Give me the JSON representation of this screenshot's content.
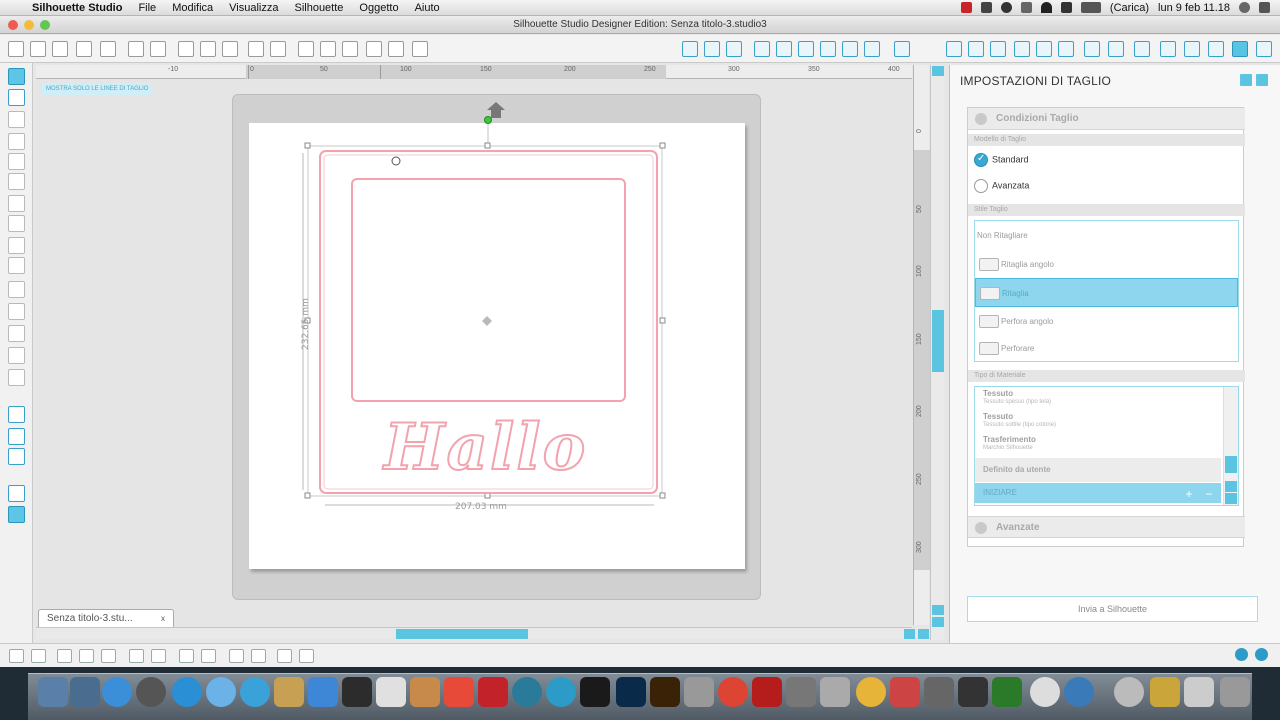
{
  "menubar": {
    "app_name": "Silhouette Studio",
    "items": [
      "File",
      "Modifica",
      "Visualizza",
      "Silhouette",
      "Oggetto",
      "Aiuto"
    ],
    "battery_text": "(Carica)",
    "clock": "lun 9 feb  11.18"
  },
  "window": {
    "title": "Silhouette Studio Designer Edition: Senza titolo-3.studio3"
  },
  "canvas": {
    "mat_label": "MOSTRA SOLO LE LINEE DI TAGLIO",
    "dimension_height": "232.65 mm",
    "dimension_width": "207.03 mm",
    "artwork_text": "Hallo",
    "ruler_top": [
      "-10",
      "0",
      "50",
      "100",
      "150",
      "200",
      "250",
      "300",
      "350",
      "400"
    ],
    "ruler_right": [
      "0",
      "50",
      "100",
      "150",
      "200",
      "250",
      "300"
    ]
  },
  "doc_tab": {
    "label": "Senza titolo-3.stu...",
    "close": "x"
  },
  "panel": {
    "title": "IMPOSTAZIONI DI TAGLIO",
    "section_cut_conditions": "Condizioni Taglio",
    "cut_mode_label": "Modello di Taglio",
    "mode_standard": "Standard",
    "mode_advanced": "Avanzata",
    "cut_style_label": "Stile Taglio",
    "blade_options": [
      "Non Ritagliare",
      "Ritaglia angolo",
      "Ritaglia",
      "Perfora angolo",
      "Perforare"
    ],
    "material_label": "Tipo di Materiale",
    "materials": [
      {
        "name": "Tessuto",
        "desc": "Tessuto spesso (tipo tela)"
      },
      {
        "name": "Tessuto",
        "desc": "Tessuto sottile (tipo cotone)"
      },
      {
        "name": "Trasferimento",
        "desc": "Marchio Silhouette"
      }
    ],
    "user_defined": "Definito da utente",
    "selected_material": "INIZIARE",
    "section_advanced": "Avanzate",
    "send_button": "Invia a Silhouette"
  },
  "colors": {
    "accent": "#5bc4e1",
    "cut_line": "#f2a3ad"
  }
}
